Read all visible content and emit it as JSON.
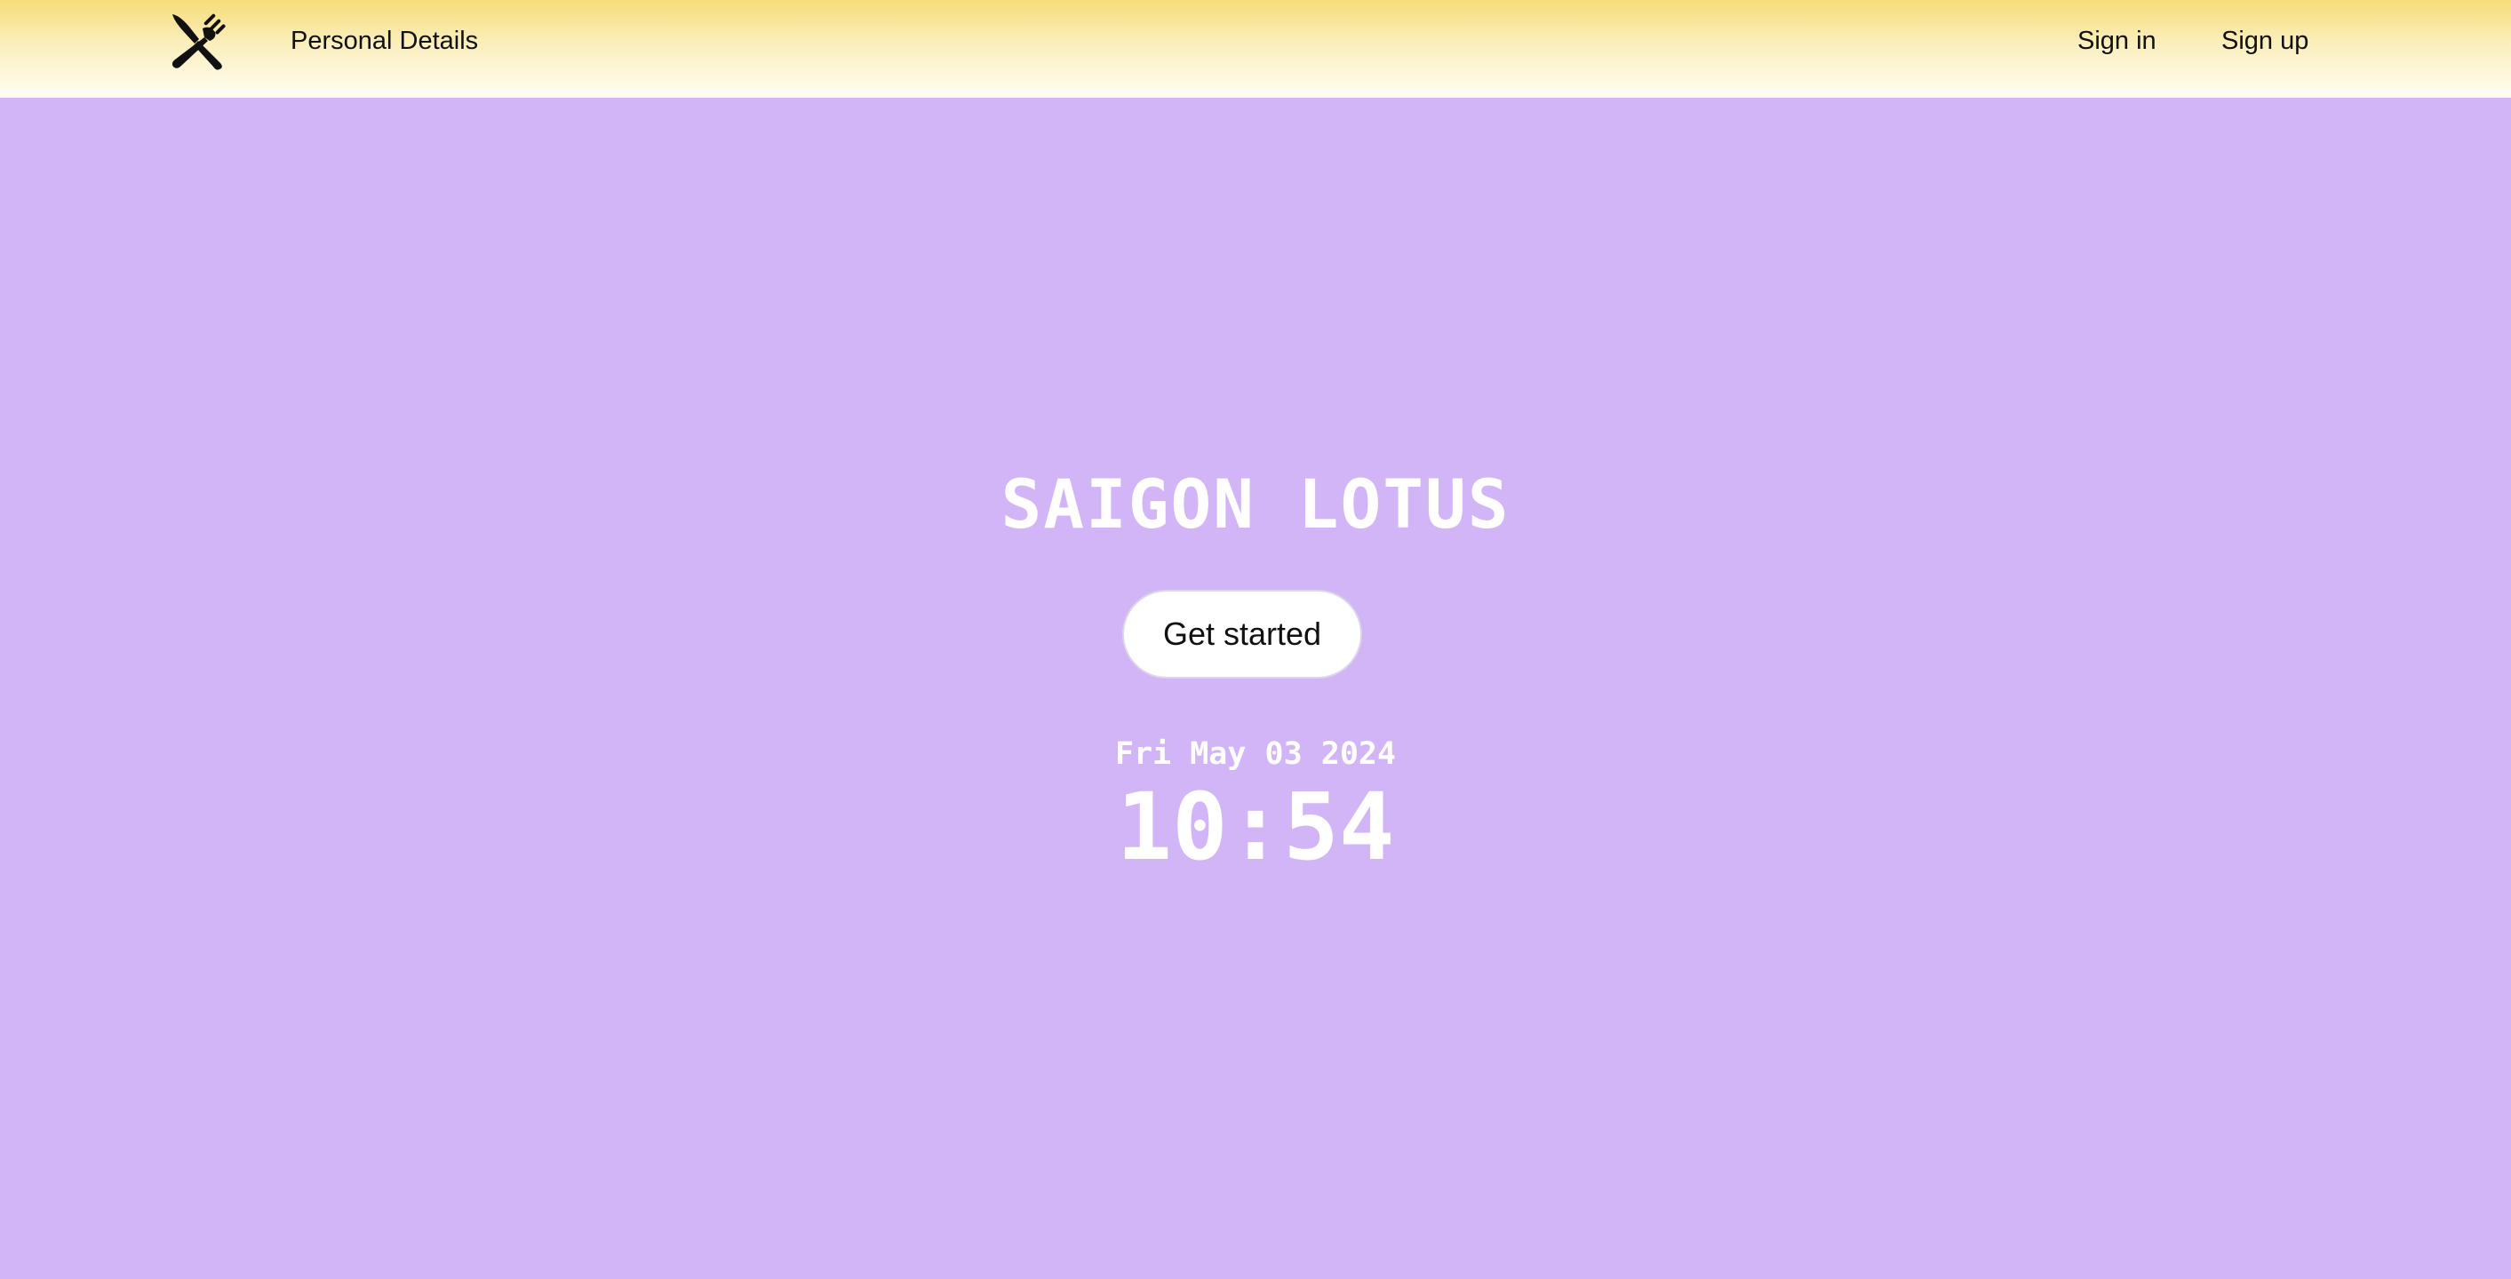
{
  "nav": {
    "logo_icon": "fork-and-knife-icon",
    "personal_details": "Personal Details",
    "sign_in": "Sign in",
    "sign_up": "Sign up"
  },
  "hero": {
    "title": "SAIGON LOTUS",
    "cta_label": "Get started",
    "date": "Fri May 03 2024",
    "time": "10:54"
  },
  "colors": {
    "header_gradient_top": "#f7dc7a",
    "header_gradient_bottom": "#fffdf4",
    "hero_background": "#d1b5f6",
    "hero_text": "#ffffff",
    "button_background": "#ffffff"
  }
}
